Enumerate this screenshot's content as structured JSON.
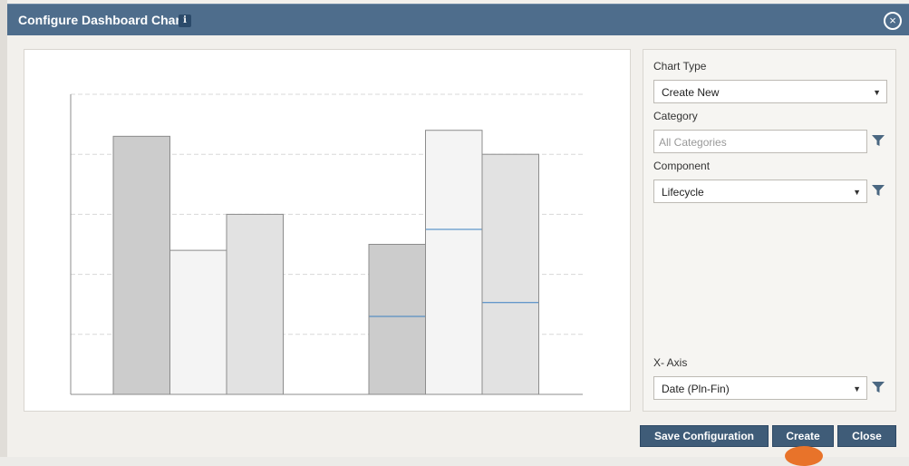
{
  "dialog": {
    "title": "Configure Dashboard Chart",
    "info_icon": "i",
    "close_icon": "×"
  },
  "form": {
    "chart_type": {
      "label": "Chart Type",
      "value": "Create New"
    },
    "category": {
      "label": "Category",
      "placeholder": "All Categories"
    },
    "component": {
      "label": "Component",
      "value": "Lifecycle"
    },
    "x_axis": {
      "label": "X- Axis",
      "value": "Date (Pln-Fin)"
    },
    "caret": "▼"
  },
  "buttons": {
    "save": "Save Configuration",
    "create": "Create",
    "close": "Close"
  },
  "colors": {
    "titlebar": "#4e6d8c",
    "button": "#3f5c78",
    "bar_dark": "#cccccc",
    "bar_light": "#f4f4f4",
    "bar_mid": "#e2e2e2",
    "segment_line": "#3a7fc1"
  },
  "chart_data": {
    "type": "bar",
    "groups": [
      {
        "bars": [
          {
            "value": 4.3
          },
          {
            "value": 2.4
          },
          {
            "value": 3.0
          }
        ]
      },
      {
        "bars": [
          {
            "value": 2.5,
            "marker": 1.3
          },
          {
            "value": 4.4,
            "marker": 2.75
          },
          {
            "value": 4.0,
            "marker": 1.53
          }
        ]
      }
    ],
    "ylim": [
      0,
      5
    ],
    "grid": true
  }
}
